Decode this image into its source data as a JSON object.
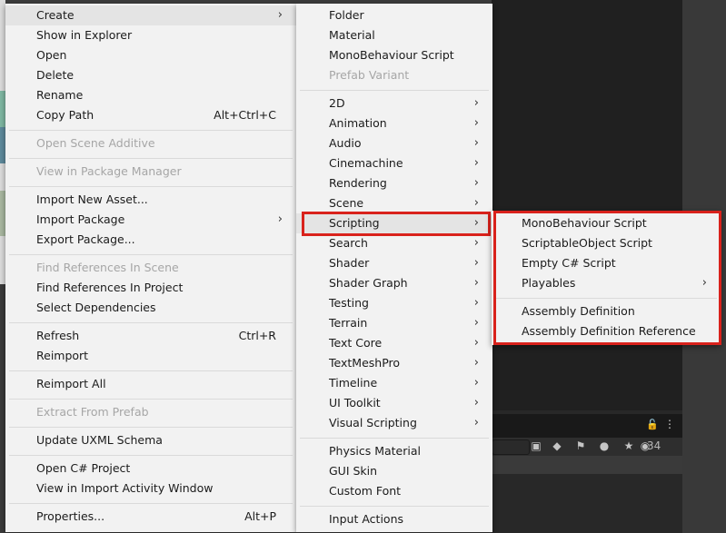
{
  "context_menu": {
    "items": [
      {
        "label": "Create",
        "submenu": true,
        "highlighted": true
      },
      {
        "label": "Show in Explorer"
      },
      {
        "label": "Open"
      },
      {
        "label": "Delete"
      },
      {
        "label": "Rename"
      },
      {
        "label": "Copy Path",
        "shortcut": "Alt+Ctrl+C"
      },
      {
        "label": "Open Scene Additive",
        "disabled": true
      },
      {
        "label": "View in Package Manager",
        "disabled": true
      },
      {
        "label": "Import New Asset..."
      },
      {
        "label": "Import Package",
        "submenu": true
      },
      {
        "label": "Export Package..."
      },
      {
        "label": "Find References In Scene",
        "disabled": true
      },
      {
        "label": "Find References In Project"
      },
      {
        "label": "Select Dependencies"
      },
      {
        "label": "Refresh",
        "shortcut": "Ctrl+R"
      },
      {
        "label": "Reimport"
      },
      {
        "label": "Reimport All"
      },
      {
        "label": "Extract From Prefab",
        "disabled": true
      },
      {
        "label": "Update UXML Schema"
      },
      {
        "label": "Open C# Project"
      },
      {
        "label": "View in Import Activity Window"
      },
      {
        "label": "Properties...",
        "shortcut": "Alt+P"
      }
    ]
  },
  "create_submenu": {
    "items": [
      {
        "label": "Folder"
      },
      {
        "label": "Material"
      },
      {
        "label": "MonoBehaviour Script"
      },
      {
        "label": "Prefab Variant",
        "disabled": true
      },
      {
        "label": "2D",
        "submenu": true
      },
      {
        "label": "Animation",
        "submenu": true
      },
      {
        "label": "Audio",
        "submenu": true
      },
      {
        "label": "Cinemachine",
        "submenu": true
      },
      {
        "label": "Rendering",
        "submenu": true
      },
      {
        "label": "Scene",
        "submenu": true
      },
      {
        "label": "Scripting",
        "submenu": true,
        "highlighted": true
      },
      {
        "label": "Search",
        "submenu": true
      },
      {
        "label": "Shader",
        "submenu": true
      },
      {
        "label": "Shader Graph",
        "submenu": true
      },
      {
        "label": "Testing",
        "submenu": true
      },
      {
        "label": "Terrain",
        "submenu": true
      },
      {
        "label": "Text Core",
        "submenu": true
      },
      {
        "label": "TextMeshPro",
        "submenu": true
      },
      {
        "label": "Timeline",
        "submenu": true
      },
      {
        "label": "UI Toolkit",
        "submenu": true
      },
      {
        "label": "Visual Scripting",
        "submenu": true
      },
      {
        "label": "Physics Material"
      },
      {
        "label": "GUI Skin"
      },
      {
        "label": "Custom Font"
      },
      {
        "label": "Input Actions"
      }
    ]
  },
  "scripting_submenu": {
    "items": [
      {
        "label": "MonoBehaviour Script"
      },
      {
        "label": "ScriptableObject Script"
      },
      {
        "label": "Empty C# Script"
      },
      {
        "label": "Playables",
        "submenu": true
      },
      {
        "label": "Assembly Definition"
      },
      {
        "label": "Assembly Definition Reference"
      }
    ]
  },
  "project_toolbar": {
    "hidden_count": "34",
    "icons": [
      "lock-icon",
      "kebab-icon",
      "scene-search-icon",
      "type-filter-icon",
      "label-filter-icon",
      "error-filter-icon",
      "favorite-icon",
      "eye-icon"
    ]
  },
  "colors": {
    "menu_bg": "#f2f2f2",
    "highlight": "#e4e4e4",
    "disabled_text": "#a6a6a6",
    "annotation_red": "#d9221c"
  }
}
